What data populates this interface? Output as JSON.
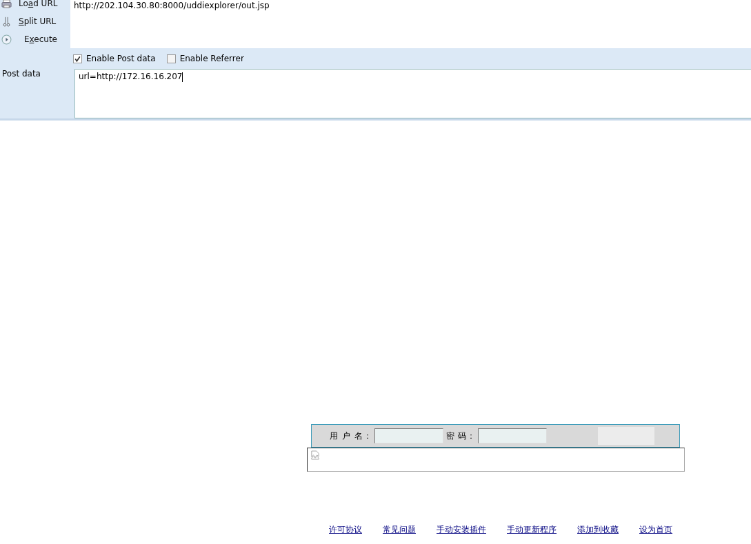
{
  "toolbar": {
    "actions": [
      {
        "kind": "load",
        "before": "Lo",
        "key": "a",
        "after": "d URL"
      },
      {
        "kind": "split",
        "key": "S",
        "after": "plit URL"
      },
      {
        "kind": "execute",
        "before": "E",
        "key": "x",
        "after": "ecute"
      }
    ],
    "url": "http://202.104.30.80:8000/uddiexplorer/out.jsp",
    "options": [
      {
        "label": "Enable Post data",
        "checked": true
      },
      {
        "label": "Enable Referrer",
        "checked": false
      }
    ],
    "post_label": "Post data",
    "post_value": "url=http://172.16.16.207"
  },
  "login": {
    "username_label": "用 户 名：",
    "password_label": "密 码："
  },
  "links": [
    "许可协议",
    "常见问题",
    "手动安装插件",
    "手动更新程序",
    "添加到收藏",
    "设为首页"
  ]
}
